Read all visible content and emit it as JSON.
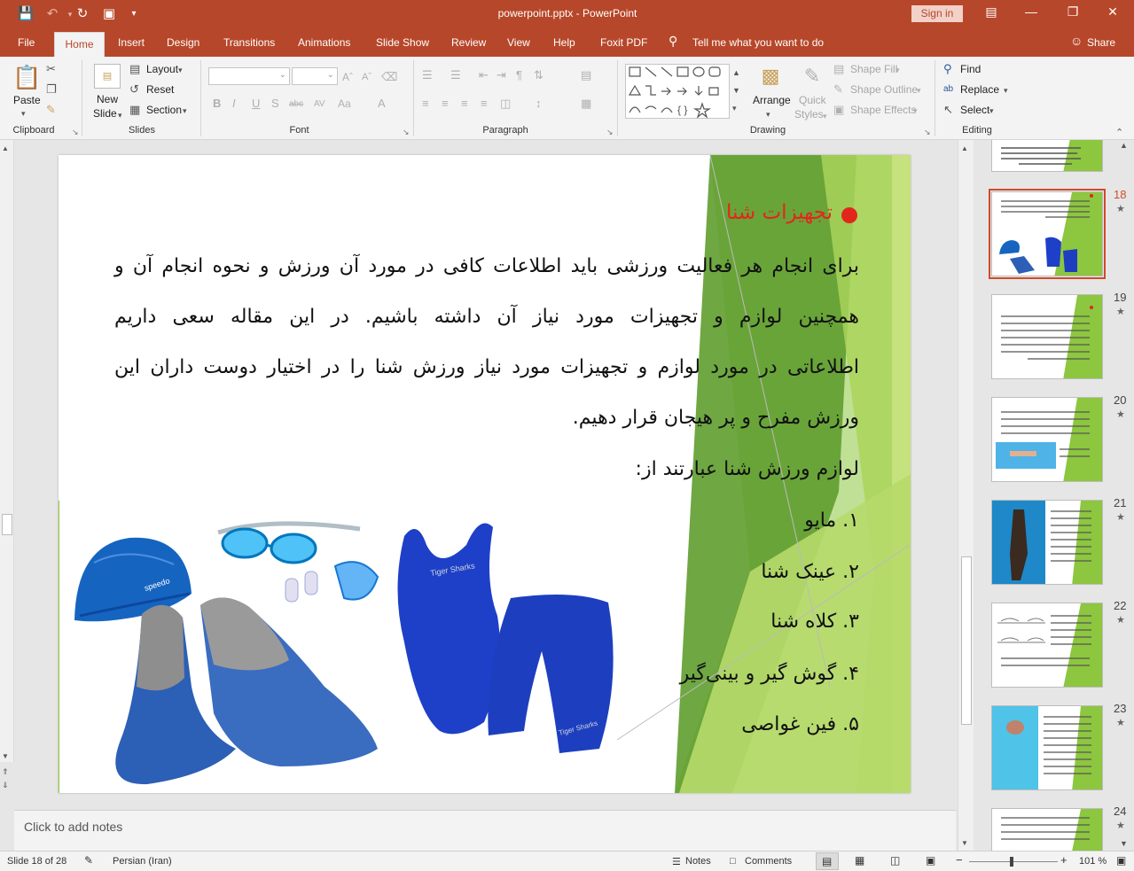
{
  "window": {
    "document_title": "powerpoint.pptx  -  PowerPoint",
    "sign_in": "Sign in",
    "share": "Share",
    "tell_me": "Tell me what you want to do"
  },
  "tabs": [
    "File",
    "Home",
    "Insert",
    "Design",
    "Transitions",
    "Animations",
    "Slide Show",
    "Review",
    "View",
    "Help",
    "Foxit PDF"
  ],
  "ribbon": {
    "clipboard": {
      "label": "Clipboard",
      "paste": "Paste"
    },
    "slides": {
      "label": "Slides",
      "new_slide_1": "New",
      "new_slide_2": "Slide",
      "layout": "Layout",
      "reset": "Reset",
      "section": "Section"
    },
    "font": {
      "label": "Font"
    },
    "paragraph": {
      "label": "Paragraph"
    },
    "drawing": {
      "label": "Drawing",
      "arrange": "Arrange",
      "quick_styles_1": "Quick",
      "quick_styles_2": "Styles",
      "shape_fill": "Shape Fill",
      "shape_outline": "Shape Outline",
      "shape_effects": "Shape Effects"
    },
    "editing": {
      "label": "Editing",
      "find": "Find",
      "replace": "Replace",
      "select": "Select"
    }
  },
  "slide": {
    "title": "تجهیزات شنا",
    "paragraph_lines": [
      "برای انجام هر فعالیت ورزشی باید اطلاعات کافی در مورد آن ورزش و نحوه انجام آن و",
      "همچنین لوازم و تجهیزات مورد نیاز آن داشته باشیم. در این مقاله سعی داریم",
      "اطلاعاتی در مورد لوازم و تجهیزات مورد نیاز ورزش شنا را در اختیار دوست داران این",
      "ورزش مفرح و پر هیجان قرار دهیم."
    ],
    "list_intro": "لوازم ورزش شنا عبارتند از:",
    "list_items": [
      "۱. مایو",
      "۲. عینک شنا",
      "۳. کلاه شنا",
      "۴. گوش گیر و بینی‌گیر",
      "۵. فین غواصی"
    ],
    "accent_color": "#e3261b",
    "green_color": "#8dc63f"
  },
  "thumbnails": {
    "numbers": [
      "18",
      "19",
      "20",
      "21",
      "22",
      "23",
      "24"
    ],
    "selected": "18"
  },
  "notes_placeholder": "Click to add notes",
  "status": {
    "slide_counter": "Slide 18 of 28",
    "language": "Persian (Iran)",
    "notes": "Notes",
    "comments": "Comments",
    "zoom": "101 %"
  }
}
